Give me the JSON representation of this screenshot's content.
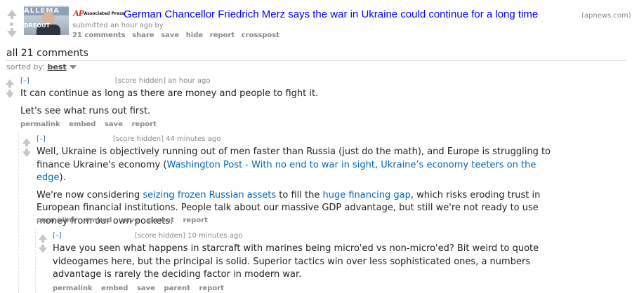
{
  "post": {
    "source_logo": "AP",
    "source_logo_sub": "Associated Press",
    "thumbnail_text_top": "ALLEMA",
    "thumbnail_text_bottom": "DREOUT",
    "title": "German Chancellor Friedrich Merz says the war in Ukraine could continue for a long time",
    "domain": "(apnews.com)",
    "tagline": "submitted an hour ago by",
    "comments_count": "21 comments",
    "buttons": [
      "share",
      "save",
      "hide",
      "report",
      "crosspost"
    ]
  },
  "comments_header": "all 21 comments",
  "sort": {
    "label": "sorted by:",
    "value": "best"
  },
  "comments": [
    {
      "toggle": "[–]",
      "score": "[score hidden]",
      "time": "an hour ago",
      "paragraphs": [
        "It can continue as long as there are money and people to fight it.",
        "Let's see what runs out first."
      ],
      "buttons": [
        "permalink",
        "embed",
        "save",
        "report"
      ]
    },
    {
      "toggle": "[–]",
      "score": "[score hidden]",
      "time": "44 minutes ago",
      "p1_before": "Well, Ukraine is objectively running out of men faster than Russia (just do the math), and Europe is struggling to finance Ukraine's economy (",
      "p1_link": "Washington Post - With no end to war in sight, Ukraine’s economy teeters on the edge",
      "p1_after": ").",
      "p2_before": "We're now considering ",
      "p2_link1": "seizing frozen Russian assets",
      "p2_mid": " to fill the ",
      "p2_link2": "huge financing gap",
      "p2_after": ", which risks eroding trust in European financial institutions. People talk about our massive GDP advantage, but still we're not ready to use money from our own pockets.",
      "buttons": [
        "permalink",
        "embed",
        "save",
        "parent",
        "report"
      ]
    },
    {
      "toggle": "[–]",
      "score": "[score hidden]",
      "time": "10 minutes ago",
      "paragraphs": [
        "Have you seen what happens in starcraft with marines being micro'ed vs non-micro'ed? Bit weird to quote videogames here, but the principal is solid. Superior tactics win over less sophisticated ones, a numbers advantage is rarely the deciding factor in modern war."
      ],
      "buttons": [
        "permalink",
        "embed",
        "save",
        "parent",
        "report"
      ]
    }
  ],
  "icons": {
    "upvote": "upvote-arrow-icon",
    "downvote": "downvote-arrow-icon",
    "sort_dropdown": "chevron-down-icon"
  }
}
